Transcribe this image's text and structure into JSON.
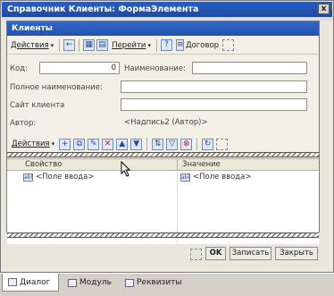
{
  "outer_window": {
    "title": "Справочник Клиенты: ФормаЭлемента",
    "close_glyph": "x"
  },
  "form": {
    "title": "Клиенты",
    "toolbar": {
      "actions_label": "Действия",
      "goto_label": "Перейти",
      "help_glyph": "?",
      "contract_label": "Договор"
    },
    "fields": {
      "code_label": "Код:",
      "code_value": "0",
      "name_label": "Наименование:",
      "name_value": "",
      "fullname_label": "Полное наименование:",
      "fullname_value": "",
      "site_label": "Сайт клиента",
      "site_value": "",
      "author_label": "Автор:",
      "author_value": "<Надпись2 (Автор)>"
    },
    "table_toolbar": {
      "actions_label": "Действия"
    },
    "grid": {
      "columns": [
        "Свойство",
        "Значение"
      ],
      "rows": [
        {
          "property": "<Поле ввода>",
          "value": "<Поле ввода>"
        }
      ]
    },
    "buttons": {
      "ok_label": "OK",
      "save_label": "Записать",
      "close_label": "Закрыть"
    }
  },
  "tabs": [
    {
      "label": "Диалог",
      "active": true
    },
    {
      "label": "Модуль",
      "active": false
    },
    {
      "label": "Реквизиты",
      "active": false
    }
  ],
  "colors": {
    "titlebar": "#2453b0",
    "panel_bg": "#f1efe6"
  }
}
